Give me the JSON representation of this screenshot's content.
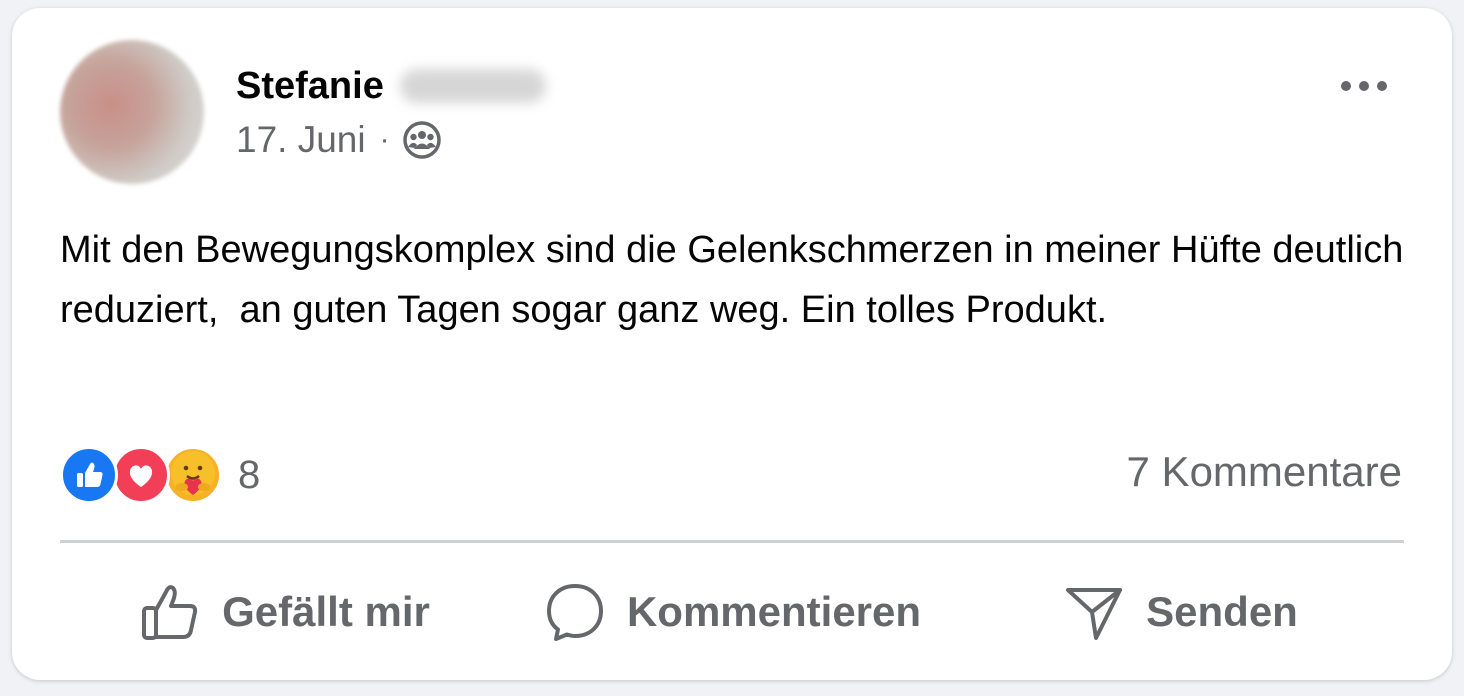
{
  "post": {
    "author_name": "Stefanie",
    "date": "17. Juni",
    "separator": "·",
    "audience_icon": "group-icon",
    "more_icon": "more-options-icon",
    "text": "Mit den Bewegungskomplex sind die Gelenkschmerzen in meiner Hüfte deutlich reduziert,  an guten Tagen sogar ganz weg. Ein tolles Produkt."
  },
  "reactions": {
    "icons": [
      "like-icon",
      "love-icon",
      "care-icon"
    ],
    "count": "8",
    "comments_label": "7 Kommentare"
  },
  "actions": {
    "like_label": "Gefällt mir",
    "comment_label": "Kommentieren",
    "send_label": "Senden"
  },
  "colors": {
    "like_blue": "#1877f2",
    "love_red": "#f33e58",
    "care_yellow": "#f7b125",
    "secondary_text": "#65676b"
  }
}
